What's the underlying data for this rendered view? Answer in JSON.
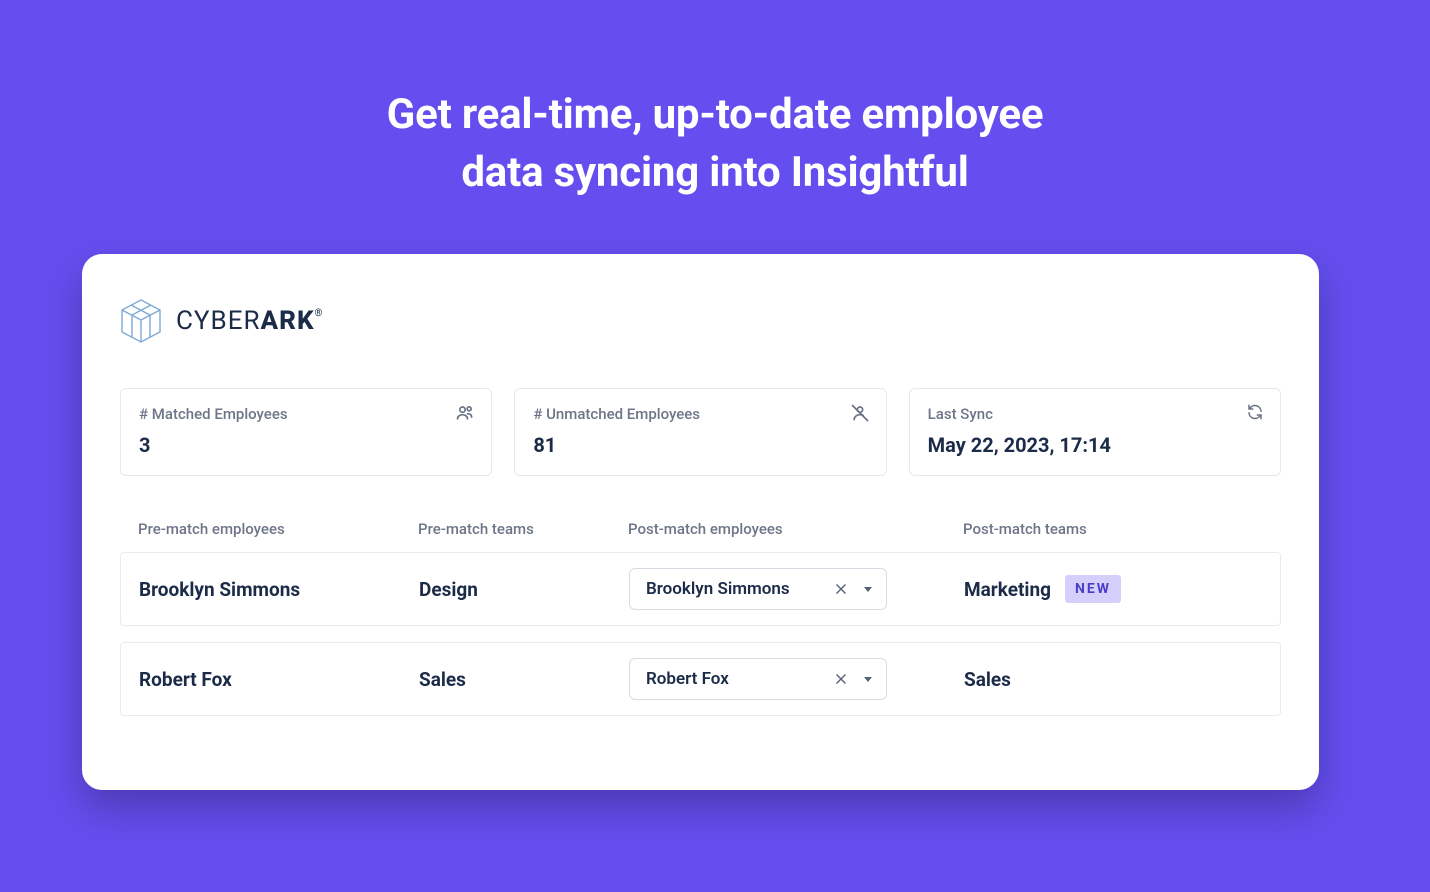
{
  "hero": {
    "line1": "Get real-time, up-to-date employee",
    "line2": "data syncing into Insightful"
  },
  "brand": {
    "name_light": "CYBER",
    "name_bold": "ARK"
  },
  "stats": {
    "matched": {
      "label": "# Matched Employees",
      "value": "3"
    },
    "unmatched": {
      "label": "# Unmatched Employees",
      "value": "81"
    },
    "lastsync": {
      "label": "Last Sync",
      "value": "May 22, 2023, 17:14"
    }
  },
  "columns": {
    "c0": "Pre-match employees",
    "c1": "Pre-match teams",
    "c2": "Post-match employees",
    "c3": "Post-match teams"
  },
  "rows": [
    {
      "pre_emp": "Brooklyn Simmons",
      "pre_team": "Design",
      "post_emp": "Brooklyn Simmons",
      "post_team": "Marketing",
      "badge": "NEW"
    },
    {
      "pre_emp": "Robert Fox",
      "pre_team": "Sales",
      "post_emp": "Robert Fox",
      "post_team": "Sales",
      "badge": ""
    }
  ]
}
